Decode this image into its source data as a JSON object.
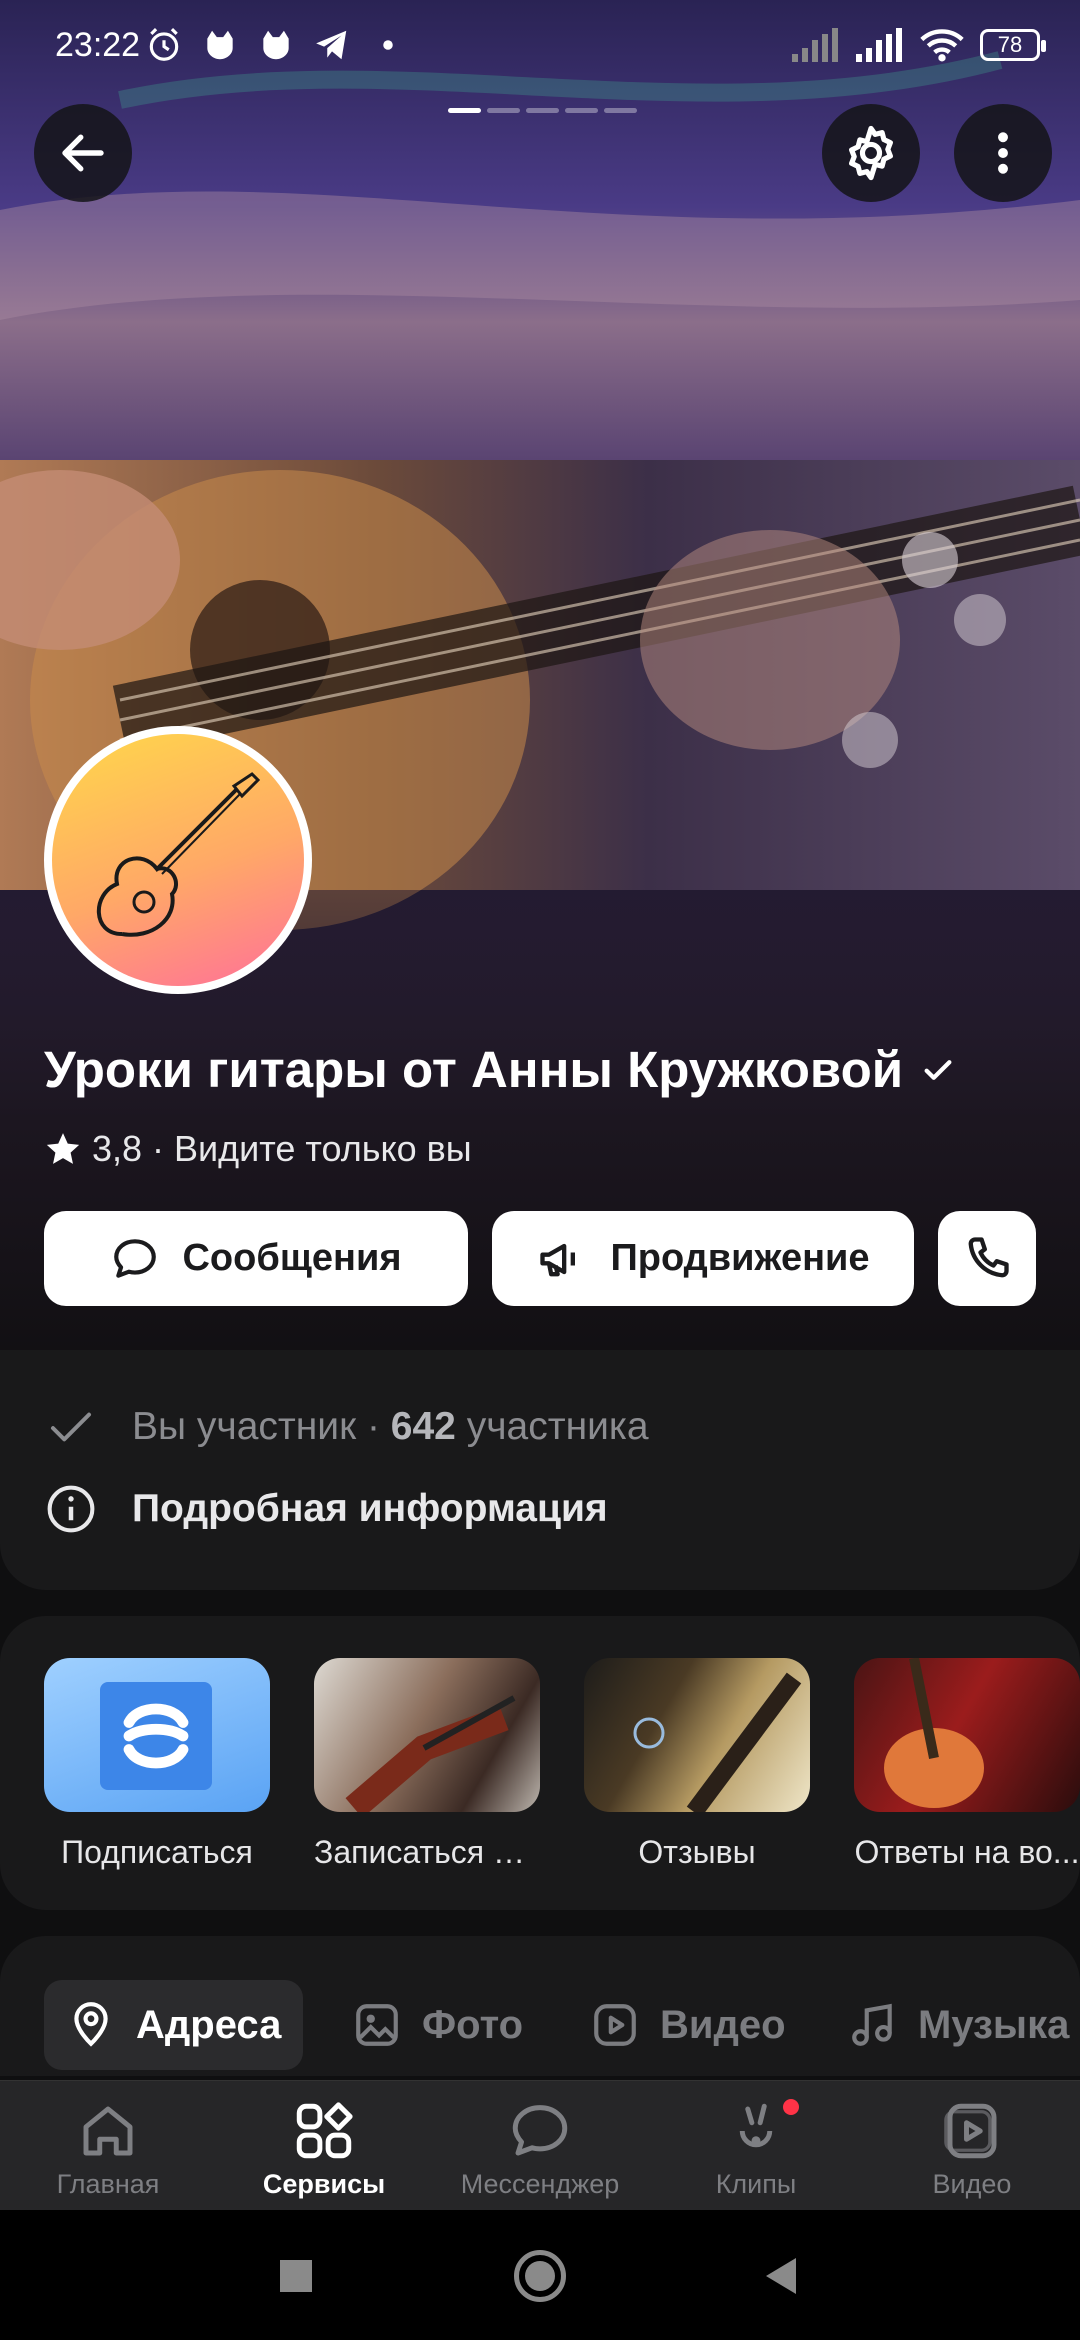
{
  "status_bar": {
    "time": "23:22",
    "battery": "78",
    "icons": [
      "alarm-icon",
      "cat-icon",
      "cat-icon",
      "telegram-icon",
      "dot-icon",
      "signal-icon",
      "signal-icon",
      "wifi-icon",
      "battery-icon"
    ]
  },
  "header": {
    "back_icon": "arrow-left-icon",
    "settings_icon": "gear-icon",
    "more_icon": "more-vertical-icon",
    "pager": {
      "count": 5,
      "active": 0
    }
  },
  "group": {
    "title": "Уроки гитары от Анны Кружковой",
    "verified_icon": "check-icon",
    "rating": "3,8",
    "visibility": "· Видите только вы"
  },
  "actions": {
    "messages_label": "Сообщения",
    "promotion_label": "Продвижение",
    "call_icon": "phone-icon"
  },
  "info": {
    "member_text": "Вы участник · ",
    "member_count": "642",
    "member_suffix": " участника",
    "details_label": "Подробная информация"
  },
  "services": [
    {
      "label": "Подписаться"
    },
    {
      "label": "Записаться на..."
    },
    {
      "label": "Отзывы"
    },
    {
      "label": "Ответы на во..."
    }
  ],
  "tabs": [
    {
      "label": "Адреса",
      "icon": "location-pin-icon",
      "active": true
    },
    {
      "label": "Фото",
      "icon": "image-icon",
      "active": false
    },
    {
      "label": "Видео",
      "icon": "play-icon",
      "active": false
    },
    {
      "label": "Музыка",
      "icon": "music-note-icon",
      "active": false
    }
  ],
  "bottom_nav": [
    {
      "label": "Главная",
      "icon": "home-icon",
      "active": false
    },
    {
      "label": "Сервисы",
      "icon": "grid-icon",
      "active": true
    },
    {
      "label": "Мессенджер",
      "icon": "chat-icon",
      "active": false
    },
    {
      "label": "Клипы",
      "icon": "clips-icon",
      "active": false,
      "badge": true
    },
    {
      "label": "Видео",
      "icon": "video-icon",
      "active": false
    }
  ],
  "colors": {
    "background": "#0f0f10",
    "card": "#19191a",
    "accent_badge": "#ff3347",
    "avatar_gradient_top": "#ffd84a",
    "avatar_gradient_bottom": "#ff6f9a"
  }
}
